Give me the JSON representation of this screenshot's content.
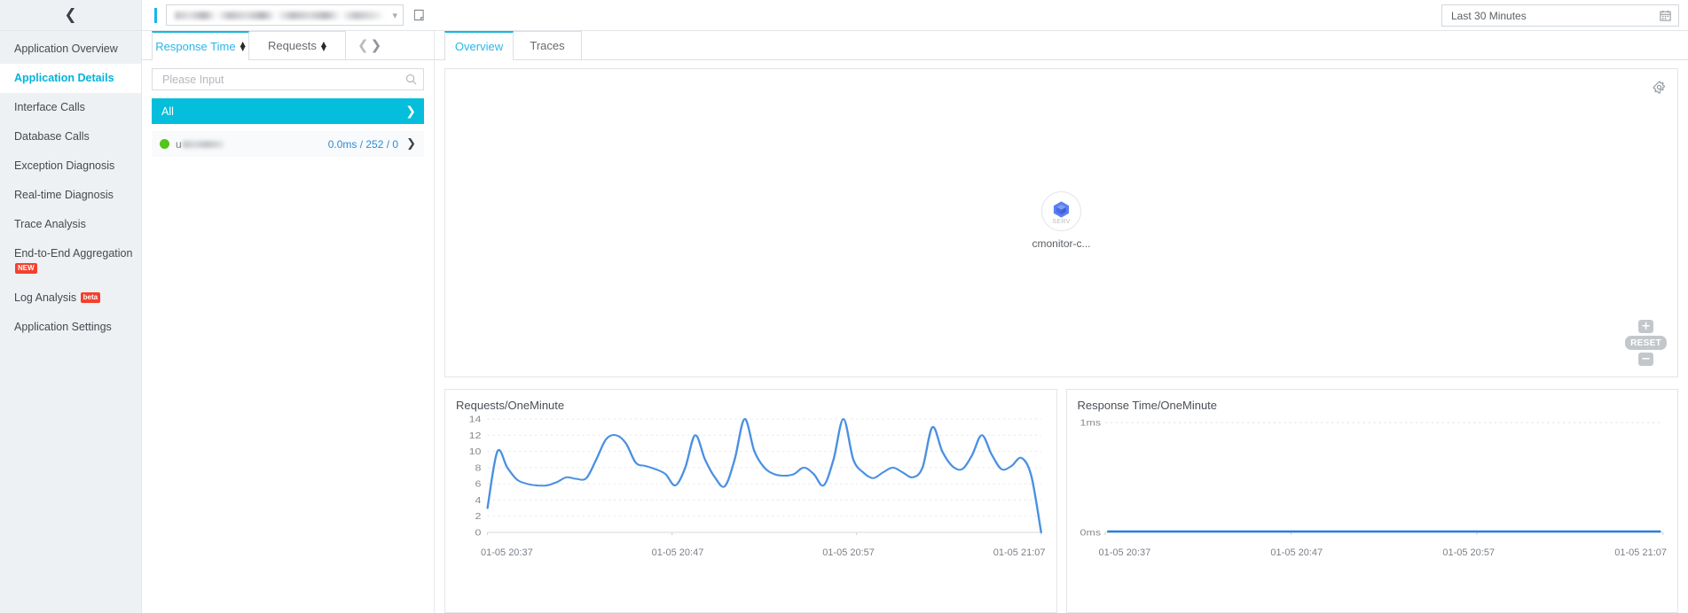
{
  "sidebar": {
    "collapse_icon": "chevron-left-icon",
    "items": [
      {
        "label": "Application Overview",
        "active": false
      },
      {
        "label": "Application Details",
        "active": true
      },
      {
        "label": "Interface Calls",
        "active": false
      },
      {
        "label": "Database Calls",
        "active": false
      },
      {
        "label": "Exception Diagnosis",
        "active": false
      },
      {
        "label": "Real-time Diagnosis",
        "active": false
      },
      {
        "label": "Trace Analysis",
        "active": false
      },
      {
        "label": "End-to-End Aggregation",
        "active": false,
        "badge": "NEW"
      },
      {
        "label": "Log Analysis",
        "active": false,
        "badge": "beta"
      },
      {
        "label": "Application Settings",
        "active": false
      }
    ]
  },
  "header": {
    "app_select_value": "",
    "app_select_icon": "chevron-down-icon",
    "copy_icon": "copy-icon",
    "time_range": "Last 30 Minutes",
    "calendar_icon": "calendar-icon"
  },
  "service_panel": {
    "tabs": [
      {
        "label": "Response Time",
        "active": true,
        "sort": true
      },
      {
        "label": "Requests",
        "active": false,
        "sort": true
      }
    ],
    "pager": {
      "prev_icon": "chevron-left-icon",
      "next_icon": "chevron-right-icon"
    },
    "search": {
      "placeholder": "Please Input",
      "value": "",
      "icon": "search-icon"
    },
    "all_row": {
      "label": "All",
      "arrow_icon": "chevron-right-icon"
    },
    "rows": [
      {
        "status_icon": "status-dot-green",
        "name_prefix": "u",
        "name": "",
        "stats": "0.0ms / 252 / 0",
        "arrow_icon": "chevron-right-icon"
      }
    ]
  },
  "main": {
    "tabs": [
      {
        "label": "Overview",
        "active": true
      },
      {
        "label": "Traces",
        "active": false
      }
    ],
    "topology": {
      "settings_icon": "gear-icon",
      "node": {
        "icon": "service-cube-icon",
        "kind": "SERV",
        "label": "cmonitor-c..."
      },
      "zoom_in_label": "+",
      "zoom_out_label": "−",
      "reset_label": "RESET"
    }
  },
  "chart_data": [
    {
      "type": "line",
      "title": "Requests/OneMinute",
      "xlabel": "",
      "ylabel": "",
      "ylim": [
        0,
        14
      ],
      "yticks": [
        0,
        2,
        4,
        6,
        8,
        10,
        12,
        14
      ],
      "xtick_labels": [
        "01-05 20:37",
        "01-05 20:47",
        "01-05 20:57",
        "01-05 21:07"
      ],
      "grid": true,
      "legend": "none",
      "color": "#4a90e2",
      "values": [
        3,
        10,
        8,
        6.5,
        6,
        5.8,
        5.8,
        6.2,
        6.8,
        6.6,
        6.7,
        9,
        11.5,
        12,
        11,
        8.6,
        8.2,
        7.8,
        7.2,
        5.8,
        8,
        12,
        9,
        6.8,
        5.7,
        9,
        14,
        10,
        8,
        7.2,
        7,
        7.2,
        8,
        7.2,
        5.8,
        9,
        14,
        9,
        7.4,
        6.7,
        7.4,
        8,
        7.4,
        6.8,
        8,
        13,
        10,
        8.2,
        7.8,
        9.5,
        12,
        9.6,
        7.8,
        8.2,
        9.2,
        7,
        0
      ]
    },
    {
      "type": "line",
      "title": "Response Time/OneMinute",
      "xlabel": "",
      "ylabel": "",
      "ylim": [
        0,
        1
      ],
      "ytick_labels": [
        "0ms",
        "1ms"
      ],
      "xtick_labels": [
        "01-05 20:37",
        "01-05 20:47",
        "01-05 20:57",
        "01-05 21:07"
      ],
      "grid": true,
      "legend": "none",
      "color": "#2b7fe0",
      "values": [
        0,
        0,
        0,
        0,
        0,
        0,
        0,
        0,
        0,
        0,
        0,
        0,
        0,
        0,
        0,
        0,
        0,
        0,
        0,
        0,
        0,
        0,
        0,
        0,
        0,
        0,
        0,
        0,
        0,
        0,
        0,
        0,
        0,
        0,
        0,
        0,
        0,
        0,
        0,
        0
      ]
    }
  ]
}
